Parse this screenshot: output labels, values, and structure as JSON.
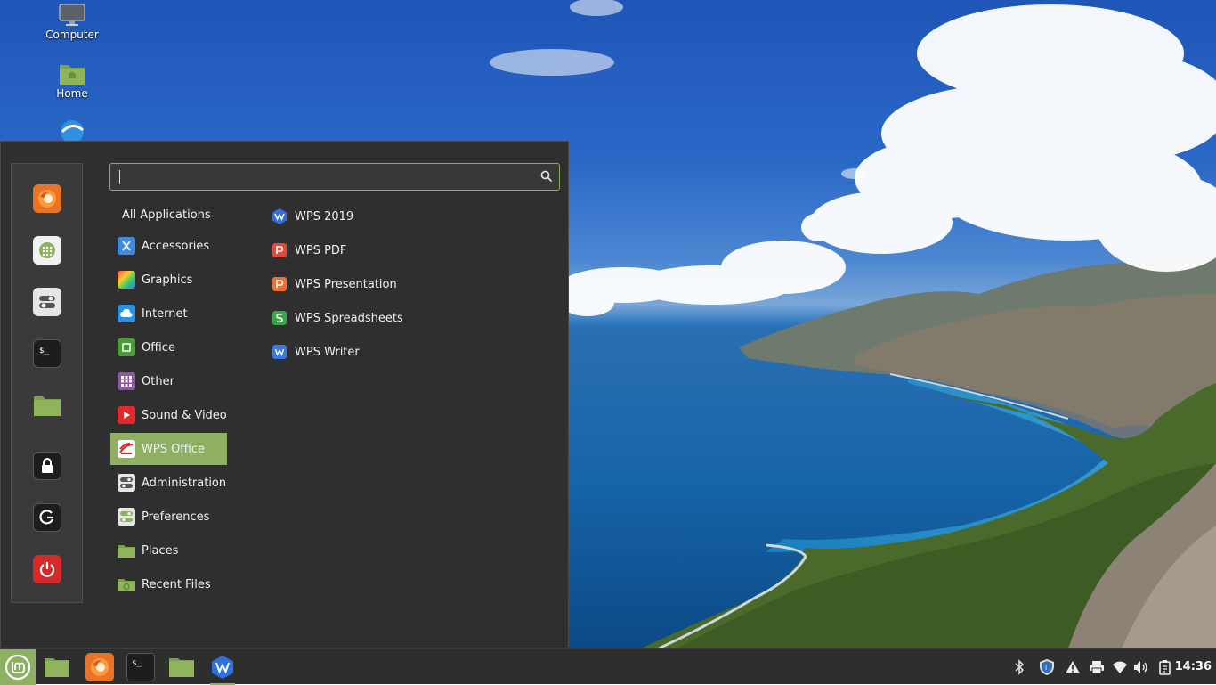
{
  "desktop": {
    "icons": [
      {
        "label": "Computer",
        "icon": "computer-icon"
      },
      {
        "label": "Home",
        "icon": "home-folder-icon"
      },
      {
        "label": "",
        "icon": "app-icon"
      }
    ]
  },
  "menu": {
    "search": {
      "value": "",
      "placeholder": "",
      "icon": "search-icon"
    },
    "favorites": [
      {
        "name": "Firefox",
        "icon": "firefox-icon"
      },
      {
        "name": "Software Manager",
        "icon": "software-manager-icon"
      },
      {
        "name": "System Settings",
        "icon": "settings-icon"
      },
      {
        "name": "Terminal",
        "icon": "terminal-icon"
      },
      {
        "name": "Files",
        "icon": "folder-icon"
      },
      {
        "name": "Lock Screen",
        "icon": "lock-icon"
      },
      {
        "name": "Log Out",
        "icon": "logout-icon"
      },
      {
        "name": "Quit",
        "icon": "power-icon"
      }
    ],
    "categories": [
      {
        "label": "All Applications"
      },
      {
        "label": "Accessories",
        "icon": "accessories-icon"
      },
      {
        "label": "Graphics",
        "icon": "graphics-icon"
      },
      {
        "label": "Internet",
        "icon": "internet-icon"
      },
      {
        "label": "Office",
        "icon": "office-icon"
      },
      {
        "label": "Other",
        "icon": "other-icon"
      },
      {
        "label": "Sound & Video",
        "icon": "sound-video-icon"
      },
      {
        "label": "WPS Office",
        "icon": "wps-office-icon",
        "selected": true
      },
      {
        "label": "Administration",
        "icon": "administration-icon"
      },
      {
        "label": "Preferences",
        "icon": "preferences-icon"
      },
      {
        "label": "Places",
        "icon": "places-icon"
      },
      {
        "label": "Recent Files",
        "icon": "recent-files-icon"
      }
    ],
    "apps": [
      {
        "label": "WPS 2019",
        "icon": "wps-2019-icon"
      },
      {
        "label": "WPS PDF",
        "icon": "wps-pdf-icon"
      },
      {
        "label": "WPS Presentation",
        "icon": "wps-presentation-icon"
      },
      {
        "label": "WPS Spreadsheets",
        "icon": "wps-spreadsheets-icon"
      },
      {
        "label": "WPS Writer",
        "icon": "wps-writer-icon"
      }
    ]
  },
  "panel": {
    "menu_button": "mint-logo-icon",
    "tasks": [
      {
        "name": "Show Desktop",
        "icon": "show-desktop-icon"
      },
      {
        "name": "Firefox",
        "icon": "firefox-icon"
      },
      {
        "name": "Terminal",
        "icon": "terminal-icon"
      },
      {
        "name": "Files",
        "icon": "folder-icon"
      },
      {
        "name": "WPS 2019",
        "icon": "wps-icon",
        "active": true
      }
    ],
    "tray": [
      "bluetooth-icon",
      "shield-icon",
      "warning-icon",
      "printer-icon",
      "wifi-icon",
      "volume-icon",
      "clipboard-icon"
    ],
    "clock": "14:36"
  },
  "colors": {
    "accent": "#8fb063",
    "menu_bg": "#2f2f2f",
    "panel_bg": "#2e2e2e"
  }
}
